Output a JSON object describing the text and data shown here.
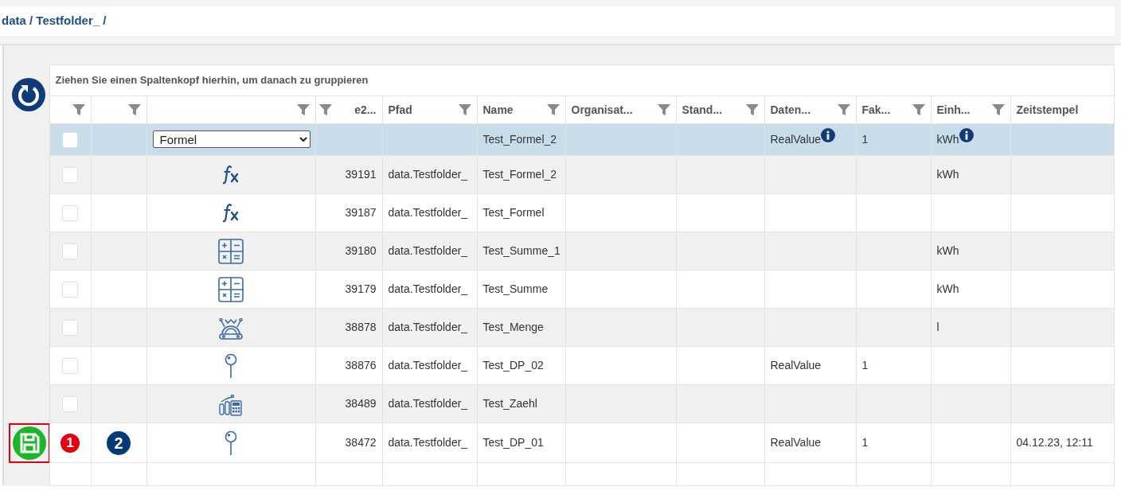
{
  "breadcrumb": "data / Testfolder_ /",
  "group_hint": "Ziehen Sie einen Spaltenkopf hierhin, um danach zu gruppieren",
  "columns": [
    {
      "filter": true
    },
    {
      "filter": true
    },
    {
      "filter": true
    },
    {
      "label": "e2...",
      "filter": true
    },
    {
      "label": "Pfad",
      "filter": true
    },
    {
      "label": "Name",
      "filter": true
    },
    {
      "label": "Organisat...",
      "filter": true
    },
    {
      "label": "Stand...",
      "filter": true
    },
    {
      "label": "Daten...",
      "filter": true
    },
    {
      "label": "Fak...",
      "filter": true
    },
    {
      "label": "Einh...",
      "filter": true
    },
    {
      "label": "Zeitstempel"
    }
  ],
  "filter_row": {
    "selected": true,
    "checked": false,
    "type": "Formel",
    "name": "Test_Formel_2",
    "datatype": "RealValue",
    "datatype_info": true,
    "factor": "1",
    "unit": "kWh",
    "unit_info": true
  },
  "rows": [
    {
      "checked": false,
      "kind": "formula",
      "id": "39191",
      "path": "data.Testfolder_",
      "name": "Test_Formel_2",
      "unit": "kWh"
    },
    {
      "checked": false,
      "kind": "formula",
      "id": "39187",
      "path": "data.Testfolder_",
      "name": "Test_Formel"
    },
    {
      "checked": false,
      "kind": "calculator",
      "id": "39180",
      "path": "data.Testfolder_",
      "name": "Test_Summe_1",
      "unit": "kWh"
    },
    {
      "checked": false,
      "kind": "calculator",
      "id": "39179",
      "path": "data.Testfolder_",
      "name": "Test_Summe",
      "unit": "kWh"
    },
    {
      "checked": false,
      "kind": "meter",
      "id": "38878",
      "path": "data.Testfolder_",
      "name": "Test_Menge",
      "unit": "l"
    },
    {
      "checked": false,
      "kind": "pin",
      "id": "38876",
      "path": "data.Testfolder_",
      "name": "Test_DP_02",
      "datatype": "RealValue",
      "factor": "1"
    },
    {
      "checked": false,
      "kind": "counter",
      "id": "38489",
      "path": "data.Testfolder_",
      "name": "Test_Zaehl"
    },
    {
      "unsaved": true,
      "markers": [
        {
          "text": "1",
          "color": "#e3000f"
        },
        {
          "text": "2",
          "color": "#003a78"
        }
      ],
      "kind": "pin",
      "id": "38472",
      "path": "data.Testfolder_",
      "name": "Test_DP_01",
      "datatype": "RealValue",
      "factor": "1",
      "timestamp": "04.12.23, 12:11"
    }
  ]
}
